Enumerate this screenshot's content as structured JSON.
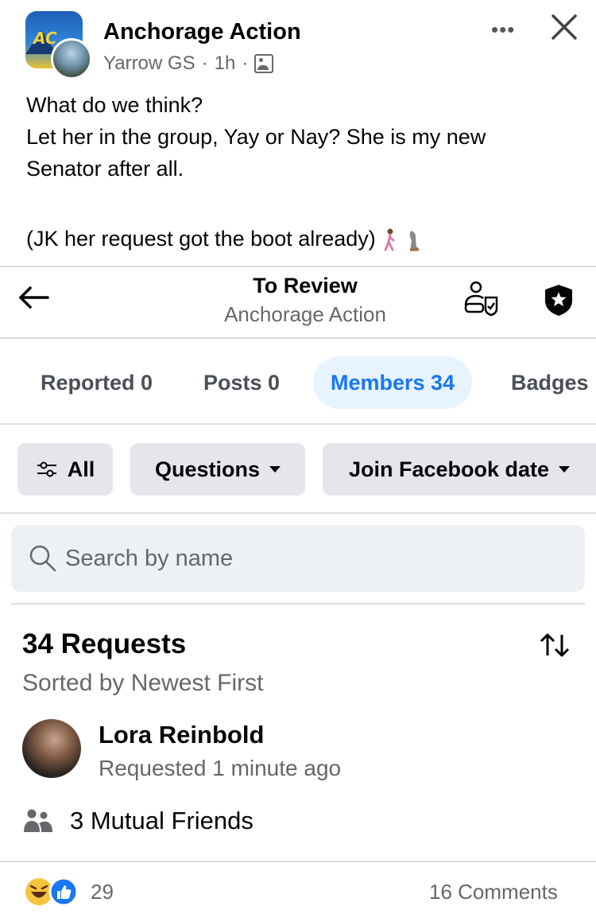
{
  "post": {
    "group_name": "Anchorage Action",
    "author": "Yarrow GS",
    "time": "1h",
    "separator": "·",
    "more_label": "•••",
    "text_lines": [
      "What do we think?",
      "Let her in the group,  Yay or Nay? She is my new",
      "Senator after all."
    ],
    "text_last": "(JK her request got the boot already)"
  },
  "review": {
    "title": "To Review",
    "subtitle": "Anchorage Action",
    "tabs": [
      {
        "label": "Reported 0"
      },
      {
        "label": "Posts 0"
      },
      {
        "label": "Members 34"
      },
      {
        "label": "Badges"
      }
    ],
    "filters": {
      "all": "All",
      "questions": "Questions",
      "join_date": "Join Facebook date"
    },
    "search": {
      "placeholder": "Search by name"
    },
    "requests_title": "34 Requests",
    "sorted_label": "Sorted by Newest First",
    "request": {
      "name": "Lora Reinbold",
      "time": "Requested 1 minute ago",
      "mutual": "3 Mutual Friends"
    }
  },
  "footer": {
    "reaction_count": "29",
    "comments": "16 Comments"
  },
  "colors": {
    "accent": "#1877f2",
    "accent_bg": "#e7f3ff",
    "secondary_text": "#65676b",
    "chip_bg": "#e4e6eb"
  }
}
